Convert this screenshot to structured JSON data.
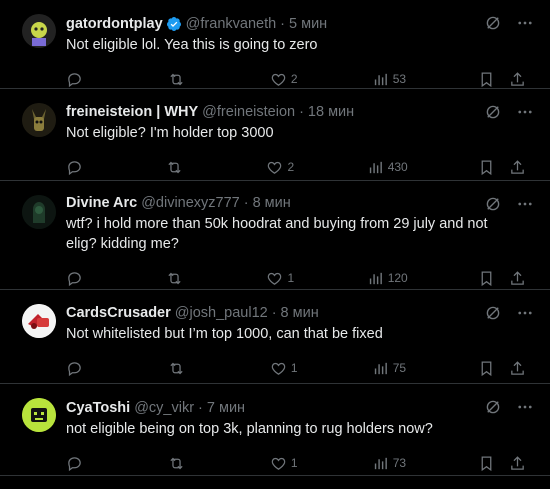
{
  "colors": {
    "background": "#000000",
    "text": "#e7e9ea",
    "muted": "#71767b",
    "border": "#2f3336",
    "verified": "#1d9bf0"
  },
  "tweets": [
    {
      "name": "gatordontplay",
      "verified": true,
      "handle": "@frankvaneth",
      "time": "5 мин",
      "text": "Not eligible lol. Yea this is going to zero",
      "likes": "2",
      "views": "53",
      "replies": "",
      "retweets": ""
    },
    {
      "name": "freineisteion | WHY",
      "verified": false,
      "handle": "@freineisteion",
      "time": "18 мин",
      "text": "Not eligible? I'm holder top 3000",
      "likes": "2",
      "views": "430",
      "replies": "",
      "retweets": ""
    },
    {
      "name": "Divine Arc",
      "verified": false,
      "handle": "@divinexyz777",
      "time": "8 мин",
      "text": "wtf? i hold more than 50k hoodrat and buying from 29 july and not elig? kidding me?",
      "likes": "1",
      "views": "120",
      "replies": "",
      "retweets": ""
    },
    {
      "name": "CardsCrusader",
      "verified": false,
      "handle": "@josh_paul12",
      "time": "8 мин",
      "text": "Not whitelisted but I’m top 1000, can that be fixed",
      "likes": "1",
      "views": "75",
      "replies": "",
      "retweets": ""
    },
    {
      "name": "CyaToshi",
      "verified": false,
      "handle": "@cy_vikr",
      "time": "7 мин",
      "text": "not eligible being on top 3k, planning to rug holders now?",
      "likes": "1",
      "views": "73",
      "replies": "",
      "retweets": ""
    }
  ],
  "separator": "·"
}
